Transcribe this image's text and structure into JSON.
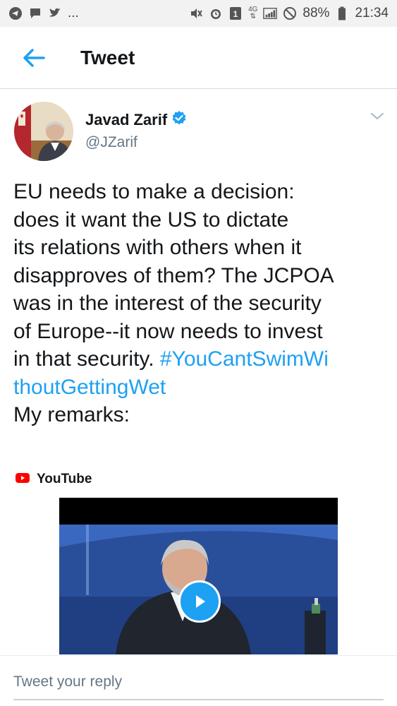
{
  "status_bar": {
    "left_icons": [
      "telegram-icon",
      "message-icon",
      "twitter-bird-icon"
    ],
    "ellipsis": "...",
    "right_icons": [
      "mute-icon",
      "alarm-icon",
      "sim-icon",
      "signal-icon",
      "no-data-icon",
      "battery-icon"
    ],
    "sim_label": "1",
    "network_label": "4G",
    "battery": "88%",
    "time": "21:34"
  },
  "header": {
    "title": "Tweet"
  },
  "tweet": {
    "author_name": "Javad Zarif",
    "handle": "@JZarif",
    "text_main": "EU needs to make a decision:\ndoes it want the US to dictate\nits relations with others when it\ndisapproves of them? The JCPOA\nwas in the interest of the security\nof Europe--it now needs to invest\nin that security. ",
    "hashtag": "#YouCantSwimWi\nthoutGettingWet",
    "text_tail": "\nMy remarks:"
  },
  "card": {
    "source": "YouTube"
  },
  "reply": {
    "placeholder": "Tweet your reply"
  },
  "colors": {
    "accent": "#1da1f2",
    "youtube_red": "#ff0000",
    "verified": "#1da1f2"
  }
}
